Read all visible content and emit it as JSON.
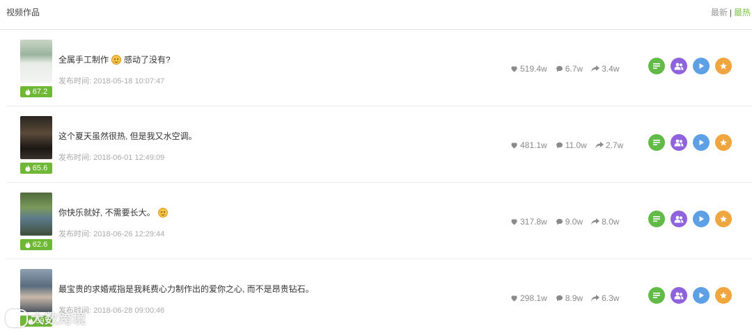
{
  "header": {
    "title": "视频作品",
    "sort_latest": "最新",
    "sort_separator": "|",
    "sort_hottest": "最热",
    "active_sort": "最热"
  },
  "colors": {
    "accent": "#7cc243",
    "heat_badge": "#6fb736",
    "action_green": "#62bb46",
    "action_purple": "#8f63dd",
    "action_blue": "#5da0e6",
    "action_orange": "#f0a63e"
  },
  "icons": {
    "heat": "flame-icon",
    "likes": "heart-icon",
    "comments": "comment-bubble-icon",
    "shares": "share-arrow-icon",
    "actions": [
      "list-icon",
      "users-icon",
      "play-icon",
      "star-icon"
    ]
  },
  "videos": [
    {
      "title": "全属手工制作",
      "title_suffix": "感动了没有?",
      "has_emoji": true,
      "time_label": "发布时间:",
      "time": "2018-05-18 10:07:47",
      "heat": "67.2",
      "likes": "519.4w",
      "comments": "6.7w",
      "shares": "3.4w"
    },
    {
      "title": "这个夏天虽然很热, 但是我又水空调。",
      "title_suffix": "",
      "has_emoji": false,
      "time_label": "发布时间:",
      "time": "2018-06-01 12:49:09",
      "heat": "65.6",
      "likes": "481.1w",
      "comments": "11.0w",
      "shares": "2.7w"
    },
    {
      "title": "你快乐就好, 不需要长大。",
      "title_suffix": "",
      "has_emoji": true,
      "time_label": "发布时间:",
      "time": "2018-06-26 12:29:44",
      "heat": "62.6",
      "likes": "317.8w",
      "comments": "9.0w",
      "shares": "8.0w"
    },
    {
      "title": "最宝贵的求婚戒指是我耗费心力制作出的爱你之心, 而不是昂贵钻石。",
      "title_suffix": "",
      "has_emoji": false,
      "time_label": "发布时间:",
      "time": "2018-06-28 09:00:46",
      "heat": "59",
      "likes": "298.1w",
      "comments": "8.9w",
      "shares": "6.3w"
    }
  ],
  "watermark": "大数跨境"
}
